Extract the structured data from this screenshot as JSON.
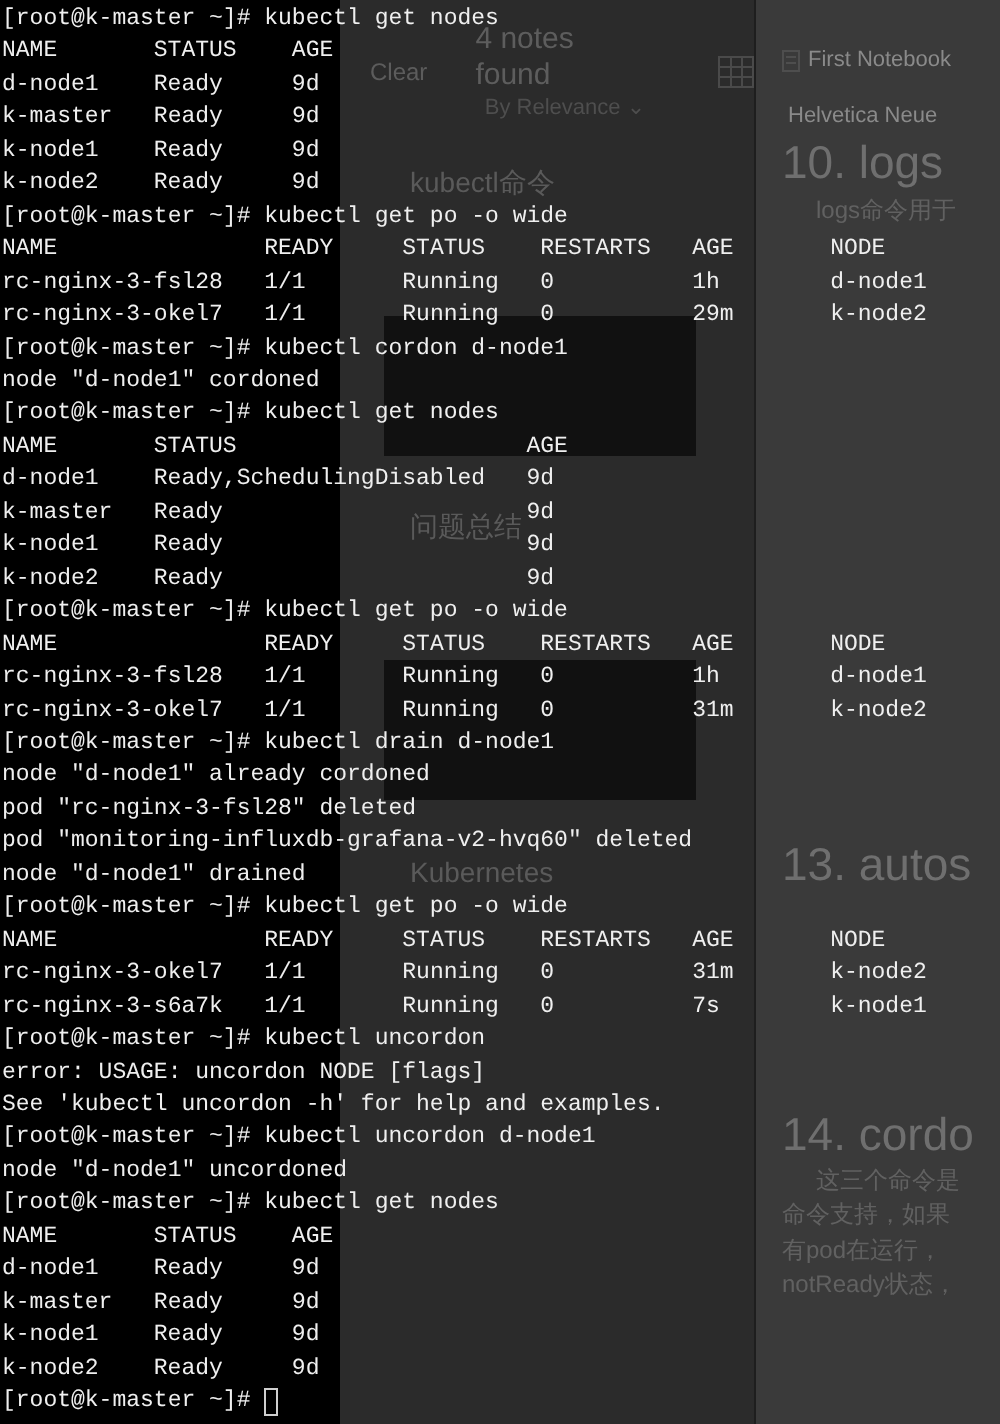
{
  "terminal": {
    "blocks": [
      {
        "kind": "line",
        "text": "[root@k-master ~]# kubectl get nodes"
      },
      {
        "kind": "table",
        "columns": [
          "NAME",
          "STATUS",
          "AGE"
        ],
        "rows": [
          [
            "d-node1",
            "Ready",
            "9d"
          ],
          [
            "k-master",
            "Ready",
            "9d"
          ],
          [
            "k-node1",
            "Ready",
            "9d"
          ],
          [
            "k-node2",
            "Ready",
            "9d"
          ]
        ]
      },
      {
        "kind": "line",
        "text": "[root@k-master ~]# kubectl get po -o wide"
      },
      {
        "kind": "table",
        "columns": [
          "NAME",
          "READY",
          "STATUS",
          "RESTARTS",
          "AGE",
          "NODE"
        ],
        "rows": [
          [
            "rc-nginx-3-fsl28",
            "1/1",
            "Running",
            "0",
            "1h",
            "d-node1"
          ],
          [
            "rc-nginx-3-okel7",
            "1/1",
            "Running",
            "0",
            "29m",
            "k-node2"
          ]
        ]
      },
      {
        "kind": "line",
        "text": "[root@k-master ~]# kubectl cordon d-node1"
      },
      {
        "kind": "line",
        "text": "node \"d-node1\" cordoned"
      },
      {
        "kind": "line",
        "text": "[root@k-master ~]# kubectl get nodes"
      },
      {
        "kind": "table",
        "columns": [
          "NAME",
          "STATUS",
          "AGE"
        ],
        "rows": [
          [
            "d-node1",
            "Ready,SchedulingDisabled",
            "9d"
          ],
          [
            "k-master",
            "Ready",
            "9d"
          ],
          [
            "k-node1",
            "Ready",
            "9d"
          ],
          [
            "k-node2",
            "Ready",
            "9d"
          ]
        ]
      },
      {
        "kind": "line",
        "text": "[root@k-master ~]# kubectl get po -o wide"
      },
      {
        "kind": "table",
        "columns": [
          "NAME",
          "READY",
          "STATUS",
          "RESTARTS",
          "AGE",
          "NODE"
        ],
        "rows": [
          [
            "rc-nginx-3-fsl28",
            "1/1",
            "Running",
            "0",
            "1h",
            "d-node1"
          ],
          [
            "rc-nginx-3-okel7",
            "1/1",
            "Running",
            "0",
            "31m",
            "k-node2"
          ]
        ]
      },
      {
        "kind": "line",
        "text": "[root@k-master ~]# kubectl drain d-node1"
      },
      {
        "kind": "line",
        "text": "node \"d-node1\" already cordoned"
      },
      {
        "kind": "line",
        "text": "pod \"rc-nginx-3-fsl28\" deleted"
      },
      {
        "kind": "line",
        "text": "pod \"monitoring-influxdb-grafana-v2-hvq60\" deleted"
      },
      {
        "kind": "line",
        "text": "node \"d-node1\" drained"
      },
      {
        "kind": "line",
        "text": "[root@k-master ~]# kubectl get po -o wide"
      },
      {
        "kind": "table",
        "columns": [
          "NAME",
          "READY",
          "STATUS",
          "RESTARTS",
          "AGE",
          "NODE"
        ],
        "rows": [
          [
            "rc-nginx-3-okel7",
            "1/1",
            "Running",
            "0",
            "31m",
            "k-node2"
          ],
          [
            "rc-nginx-3-s6a7k",
            "1/1",
            "Running",
            "0",
            "7s",
            "k-node1"
          ]
        ]
      },
      {
        "kind": "line",
        "text": "[root@k-master ~]# kubectl uncordon"
      },
      {
        "kind": "line",
        "text": "error: USAGE: uncordon NODE [flags]"
      },
      {
        "kind": "line",
        "text": "See 'kubectl uncordon -h' for help and examples."
      },
      {
        "kind": "line",
        "text": "[root@k-master ~]# kubectl uncordon d-node1"
      },
      {
        "kind": "line",
        "text": "node \"d-node1\" uncordoned"
      },
      {
        "kind": "line",
        "text": "[root@k-master ~]# kubectl get nodes"
      },
      {
        "kind": "table",
        "columns": [
          "NAME",
          "STATUS",
          "AGE"
        ],
        "rows": [
          [
            "d-node1",
            "Ready",
            "9d"
          ],
          [
            "k-master",
            "Ready",
            "9d"
          ],
          [
            "k-node1",
            "Ready",
            "9d"
          ],
          [
            "k-node2",
            "Ready",
            "9d"
          ]
        ]
      }
    ],
    "prompt": "[root@k-master ~]#"
  },
  "notes_list": {
    "clear_button": "Clear",
    "title": "4 notes found",
    "sort": "By Relevance ⌄",
    "notes": [
      {
        "title": "kubectl命令",
        "thumbnail": true
      },
      {
        "title": "问题总结",
        "thumbnail": true
      },
      {
        "title": "Kubernetes",
        "thumbnail": false
      }
    ]
  },
  "note": {
    "notebook": "First Notebook",
    "font": "Helvetica Neue",
    "blocks": [
      {
        "kind": "heading",
        "text": "10. logs"
      },
      {
        "kind": "paragraph",
        "text": "logs命令用于"
      },
      {
        "kind": "heading",
        "text": "13. autos"
      },
      {
        "kind": "heading",
        "text": "14. cordo"
      },
      {
        "kind": "paragraph",
        "text": "这三个命令是"
      },
      {
        "kind": "line",
        "text": "命令支持，如果"
      },
      {
        "kind": "line",
        "text": "有pod在运行，"
      },
      {
        "kind": "line",
        "text": "notReady状态，"
      }
    ]
  }
}
